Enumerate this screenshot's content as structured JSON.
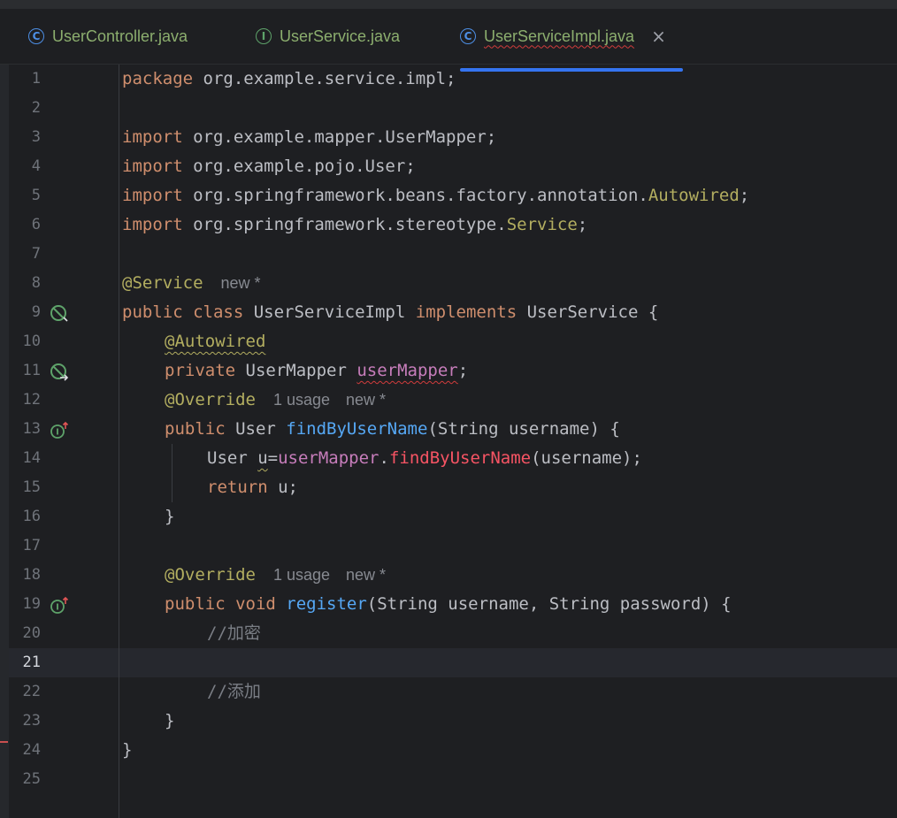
{
  "tabs": [
    {
      "label": "UserController.java",
      "icon": "class-icon",
      "active": false
    },
    {
      "label": "UserService.java",
      "icon": "interface-icon",
      "active": false
    },
    {
      "label": "UserServiceImpl.java",
      "icon": "class-icon",
      "active": true,
      "close": "×"
    }
  ],
  "icon_letters": {
    "class": "C",
    "interface": "I"
  },
  "colors": {
    "background": "#1e1f22",
    "keyword": "#cf8e6d",
    "annotation": "#b3ae60",
    "method": "#56a8f5",
    "field": "#c77dbb",
    "comment": "#7a7e85",
    "accent": "#3574f0"
  },
  "line_numbers": [
    "1",
    "2",
    "3",
    "4",
    "5",
    "6",
    "7",
    "8",
    "9",
    "10",
    "11",
    "12",
    "13",
    "14",
    "15",
    "16",
    "17",
    "18",
    "19",
    "20",
    "21",
    "22",
    "23",
    "24",
    "25"
  ],
  "code": {
    "l1": {
      "kw": "package",
      "rest": " org.example.service.impl;"
    },
    "l3": {
      "kw": "import",
      "rest": " org.example.mapper.UserMapper;"
    },
    "l4": {
      "kw": "import",
      "rest": " org.example.pojo.User;"
    },
    "l5": {
      "kw": "import",
      "rest": " org.springframework.beans.factory.annotation.",
      "ann": "Autowired",
      "end": ";"
    },
    "l6": {
      "kw": "import",
      "rest": " org.springframework.stereotype.",
      "ann": "Service",
      "end": ";"
    },
    "l8": {
      "ann": "@Service",
      "hint_new": "new *"
    },
    "l9": {
      "kw1": "public class",
      "name": " UserServiceImpl ",
      "kw2": "implements",
      "rest": " UserService {"
    },
    "l10": {
      "ann": "@Autowired"
    },
    "l11": {
      "kw": "private",
      "type": " UserMapper ",
      "field": "userMapper",
      "end": ";"
    },
    "l12": {
      "ann": "@Override",
      "hint_usage": "1 usage",
      "hint_new": "new *"
    },
    "l13": {
      "kw": "public",
      "type": " User ",
      "fn": "findByUserName",
      "rest": "(String username) {"
    },
    "l14": {
      "type": "User ",
      "var": "u",
      "eq": "=",
      "field": "userMapper",
      "dot": ".",
      "err": "findByUserName",
      "rest": "(username);"
    },
    "l15": {
      "kw": "return",
      "rest": " u;"
    },
    "l16": {
      "rest": "}"
    },
    "l18": {
      "ann": "@Override",
      "hint_usage": "1 usage",
      "hint_new": "new *"
    },
    "l19": {
      "kw": "public void",
      "fn": " register",
      "rest": "(String username, String password) {"
    },
    "l20": {
      "comment": "//加密"
    },
    "l22": {
      "comment": "//添加"
    },
    "l23": {
      "rest": "}"
    },
    "l24": {
      "rest": "}"
    }
  }
}
